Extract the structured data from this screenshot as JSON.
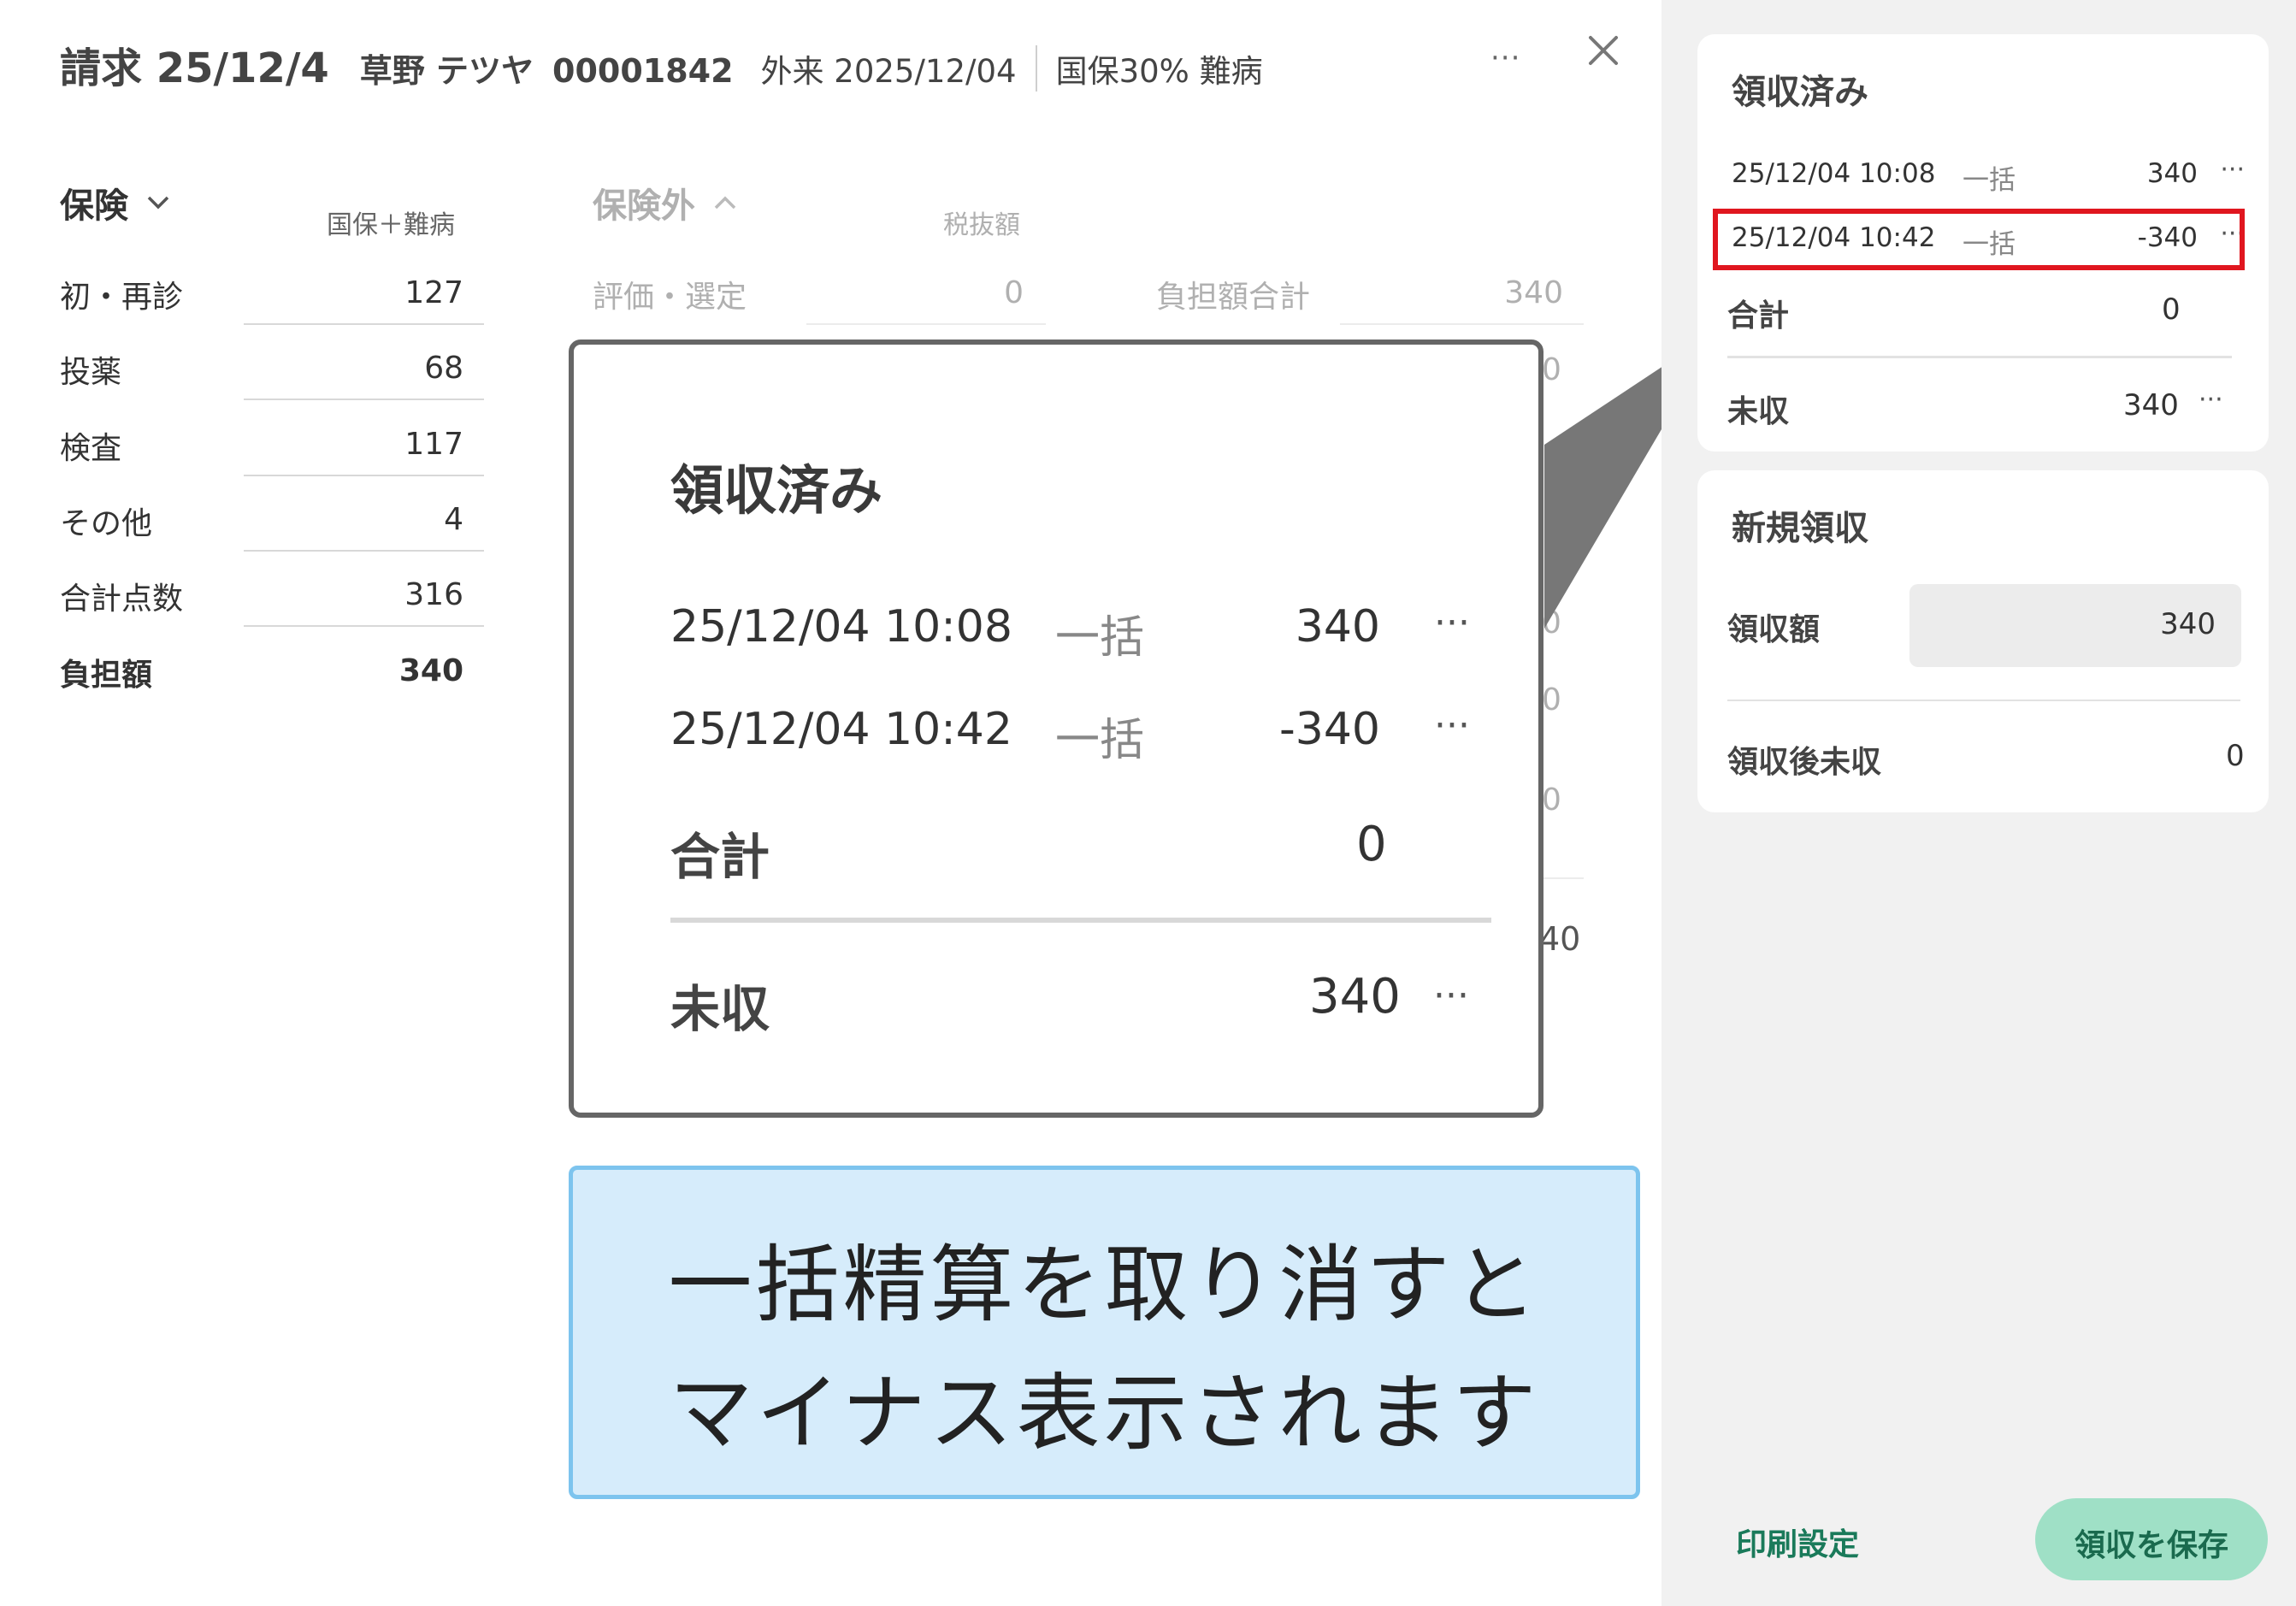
{
  "header": {
    "title": "請求 25/12/4",
    "patient_name": "草野 テツヤ",
    "patient_id": "00001842",
    "visit": "外来 2025/12/04",
    "insurance": "国保30% 難病",
    "more": "···"
  },
  "insurance": {
    "label": "保険",
    "sub_label": "国保＋難病",
    "rows": [
      {
        "label": "初・再診",
        "value": "127"
      },
      {
        "label": "投薬",
        "value": "68"
      },
      {
        "label": "検査",
        "value": "117"
      },
      {
        "label": "その他",
        "value": "4"
      },
      {
        "label": "合計点数",
        "value": "316"
      },
      {
        "label": "負担額",
        "value": "340"
      }
    ]
  },
  "non_insurance": {
    "label": "保険外",
    "sub_label": "税抜額",
    "row_label": "評価・選定",
    "row_value": "0",
    "total_label": "負担額合計",
    "total_value": "340",
    "peek_values": [
      "0",
      "0",
      "0",
      "0",
      "40"
    ]
  },
  "callout": {
    "title": "領収済み",
    "rows": [
      {
        "date": "25/12/04 10:08",
        "type": "一括",
        "amount": "340",
        "more": "···"
      },
      {
        "date": "25/12/04 10:42",
        "type": "一括",
        "amount": "-340",
        "more": "···"
      }
    ],
    "total_label": "合計",
    "total_value": "0",
    "unpaid_label": "未収",
    "unpaid_value": "340",
    "unpaid_more": "···"
  },
  "note": {
    "line1": "一括精算を取り消すと",
    "line2": "マイナス表示されます"
  },
  "received": {
    "title": "領収済み",
    "rows": [
      {
        "date": "25/12/04 10:08",
        "type": "一括",
        "amount": "340",
        "more": "···"
      },
      {
        "date": "25/12/04 10:42",
        "type": "一括",
        "amount": "-340",
        "more": "···"
      }
    ],
    "total_label": "合計",
    "total_value": "0",
    "unpaid_label": "未収",
    "unpaid_value": "340",
    "unpaid_more": "···"
  },
  "new_receipt": {
    "title": "新規領収",
    "amount_label": "領収額",
    "amount_value": "340",
    "after_label": "領収後未収",
    "after_value": "0"
  },
  "footer": {
    "print_label": "印刷設定",
    "save_label": "領収を保存"
  },
  "colors": {
    "highlight": "#e0161f",
    "note_bg": "#d6ecfb",
    "note_border": "#7dc4ee",
    "save_bg": "#9fe0c6",
    "accent_text": "#1a7a5a"
  }
}
